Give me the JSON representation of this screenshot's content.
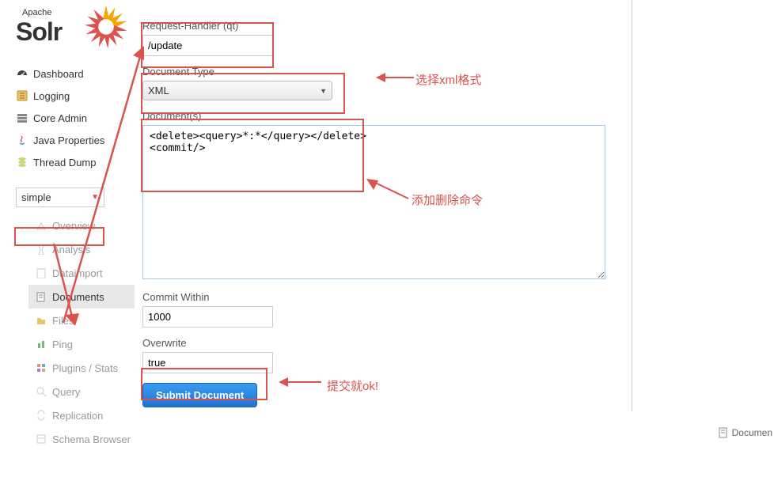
{
  "logo": {
    "apache": "Apache",
    "solr": "Solr"
  },
  "sidebar": {
    "items": [
      {
        "label": "Dashboard"
      },
      {
        "label": "Logging"
      },
      {
        "label": "Core Admin"
      },
      {
        "label": "Java Properties"
      },
      {
        "label": "Thread Dump"
      }
    ],
    "core_selected": "simple",
    "sub_items": [
      {
        "label": "Overview"
      },
      {
        "label": "Analysis"
      },
      {
        "label": "Dataimport"
      },
      {
        "label": "Documents"
      },
      {
        "label": "Files"
      },
      {
        "label": "Ping"
      },
      {
        "label": "Plugins / Stats"
      },
      {
        "label": "Query"
      },
      {
        "label": "Replication"
      },
      {
        "label": "Schema Browser"
      }
    ]
  },
  "form": {
    "qt_label": "Request-Handler (qt)",
    "qt_value": "/update",
    "doctype_label": "Document Type",
    "doctype_value": "XML",
    "docs_label": "Document(s)",
    "docs_value": "<delete><query>*:*</query></delete>\n<commit/>",
    "commit_label": "Commit Within",
    "commit_value": "1000",
    "overwrite_label": "Overwrite",
    "overwrite_value": "true",
    "submit_label": "Submit Document"
  },
  "annotations": {
    "a1": "选择xml格式",
    "a2": "添加删除命令",
    "a3": "提交就ok!"
  },
  "footer": {
    "label": "Documen"
  }
}
